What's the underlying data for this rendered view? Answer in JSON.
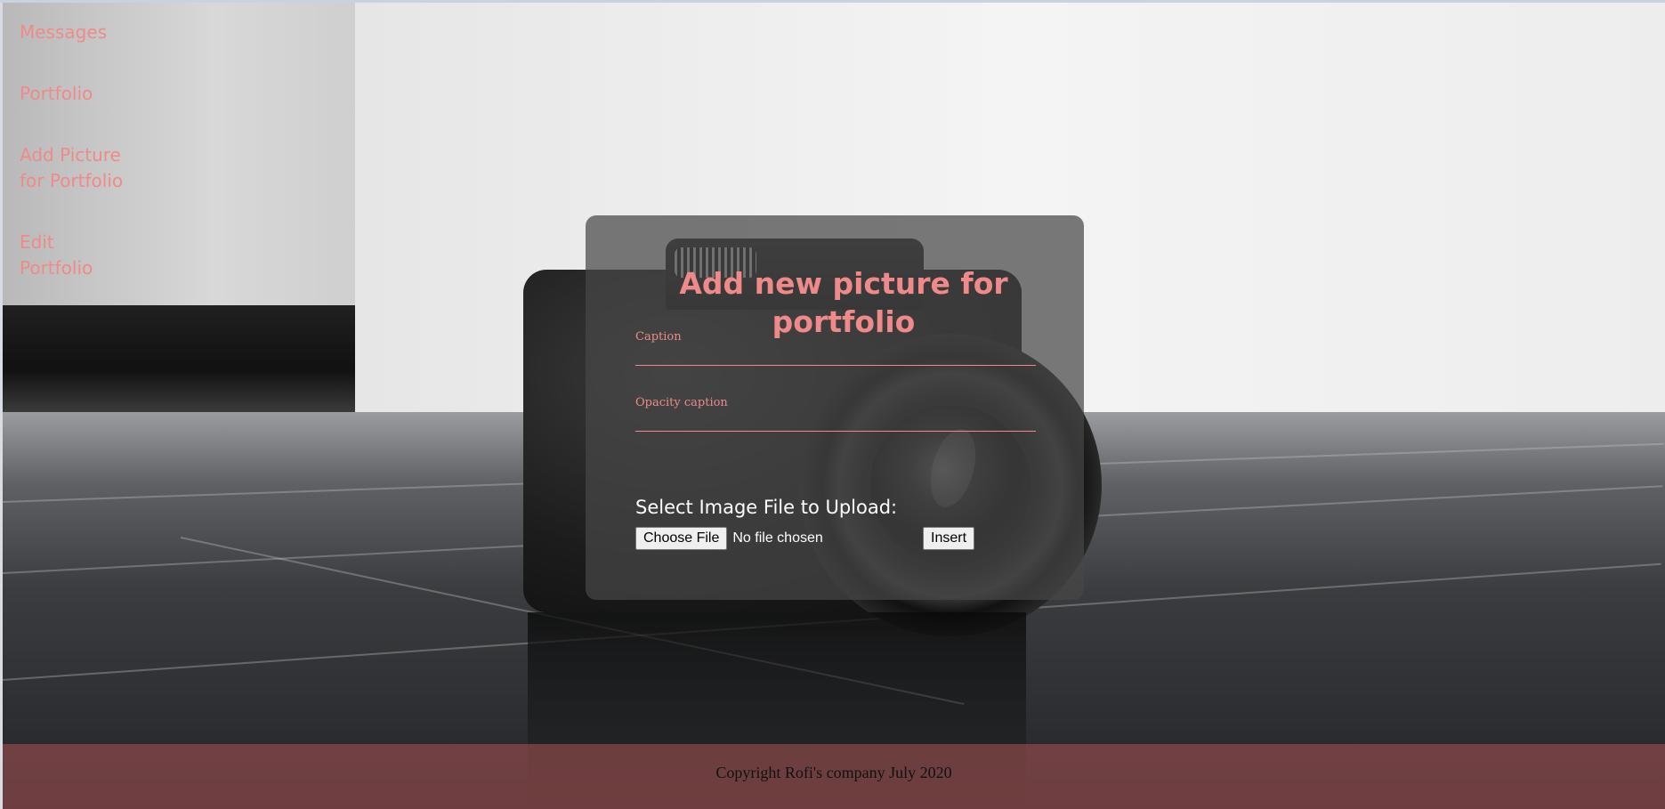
{
  "sidebar": {
    "items": [
      {
        "label": "Messages"
      },
      {
        "label": "Portfolio"
      },
      {
        "label": "Add Picture for Portfolio"
      },
      {
        "label": "Edit Portfolio"
      }
    ]
  },
  "form": {
    "title": "Add new picture for portfolio",
    "caption_label": "Caption",
    "opacity_caption_label": "Opacity caption",
    "upload_label": "Select Image File to Upload:",
    "choose_file_label": "Choose File",
    "no_file_text": "No file chosen",
    "insert_label": "Insert"
  },
  "footer": {
    "text": "Copyright Rofi's company July 2020"
  },
  "colors": {
    "accent": "#f08a8a",
    "card_bg": "#464646",
    "footer_bg": "#a05050"
  },
  "background": {
    "description": "photo-background"
  }
}
